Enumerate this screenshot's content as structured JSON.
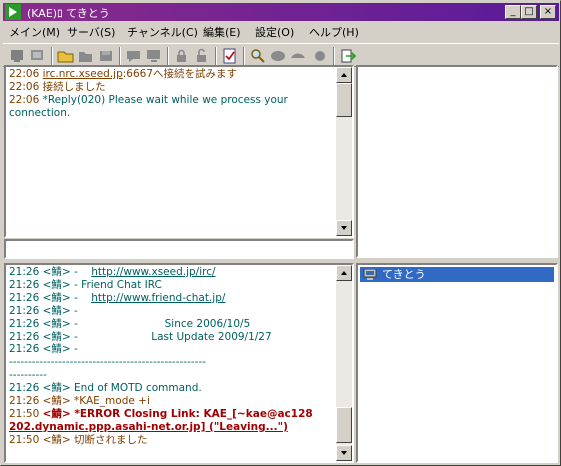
{
  "window": {
    "title": "(KAE)ﾛ てきとう",
    "controls": {
      "minimize": "_",
      "maximize": "□",
      "close": "×"
    }
  },
  "menu": [
    {
      "label": "メイン(M)"
    },
    {
      "label": "サーバ(S)"
    },
    {
      "label": "チャンネル(C)"
    },
    {
      "label": "編集(E)"
    },
    {
      "label": "設定(O)"
    },
    {
      "label": "ヘルプ(H)"
    }
  ],
  "server_log": [
    {
      "time": "22:06",
      "text": "irc.nrc.xseed.jp:6667へ接続を試みます",
      "style": "c-brown"
    },
    {
      "time": "22:06",
      "text": "接続しました",
      "style": "c-brown"
    },
    {
      "time": "22:06",
      "text": "*Reply(020) Please wait while we process your",
      "style": "c-teal"
    },
    {
      "time": "",
      "text": " connection.",
      "style": "c-teal"
    }
  ],
  "channel_log": [
    {
      "time": "21:26",
      "text": "<鯖> -    http://www.xseed.jp/irc/",
      "style": "c-teal"
    },
    {
      "time": "21:26",
      "text": "<鯖> -   Friend Chat IRC",
      "style": "c-teal"
    },
    {
      "time": "21:26",
      "text": "<鯖> -    http://www.friend-chat.jp/",
      "style": "c-teal"
    },
    {
      "time": "21:26",
      "text": "<鯖> -",
      "style": "c-teal"
    },
    {
      "time": "21:26",
      "text": "<鯖> -                          Since 2006/10/5",
      "style": "c-teal"
    },
    {
      "time": "21:26",
      "text": "<鯖> -                      Last Update 2009/1/27",
      "style": "c-teal"
    },
    {
      "time": "21:26",
      "text": "<鯖> -",
      "style": "c-teal"
    },
    {
      "time": "",
      "text": "----------------------------------------------------",
      "style": "c-teal"
    },
    {
      "time": "",
      "text": "----------",
      "style": "c-teal"
    },
    {
      "time": "21:26",
      "text": "<鯖> End of MOTD command.",
      "style": "c-teal"
    },
    {
      "time": "21:26",
      "text": "<鯖> *KAE_mode +i",
      "style": "c-brown"
    },
    {
      "time": "21:50",
      "text": "<鯖> *ERROR Closing Link: KAE_[~kae@ac128",
      "style": "c-red"
    },
    {
      "time": "",
      "text": " 202.dynamic.ppp.asahi-net.or.jp] (\"Leaving...\")",
      "style": "c-red"
    },
    {
      "time": "21:50",
      "text": "<鯖> 切断されました",
      "style": "c-brown"
    }
  ],
  "nick_list": [
    {
      "name": "てきとう"
    }
  ],
  "icons": [
    "app-icon",
    "disconnect-icon",
    "connect-icon",
    "folder-icon",
    "open-icon",
    "save-icon",
    "chat-icon",
    "monitor-icon",
    "lock-icon",
    "unlock-icon",
    "check-icon",
    "search-icon",
    "mask-icon",
    "help-icon",
    "exit-icon"
  ]
}
